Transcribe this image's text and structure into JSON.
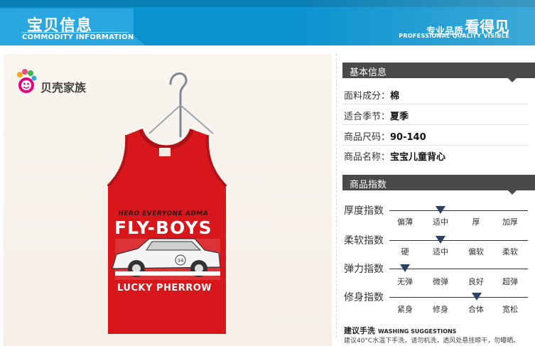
{
  "header": {
    "title": "宝贝信息",
    "subtitle": "COMMODITY INFORMATION",
    "slogan_small": "专业品质",
    "slogan_big": "看得见",
    "slogan_en": "PROFESSIONAL QUALITY VISIBLE"
  },
  "product": {
    "brand_logo_text": "贝壳家族",
    "print_small": "HERO EVERYONE ADMA",
    "print_big": "FLY-BOYS",
    "print_bottom": "LUCKY PHERROW",
    "car_number": "34",
    "colors": {
      "shirt": "#d8171c",
      "banner": "#0b93cf",
      "tab": "#2aa7e0",
      "section_head": "#4a4a4a"
    }
  },
  "basic_info": {
    "heading": "基本信息",
    "rows": [
      {
        "key": "面料成分：",
        "value": "棉"
      },
      {
        "key": "适合季节：",
        "value": "夏季"
      },
      {
        "key": "商品尺码：",
        "value": "90-140"
      },
      {
        "key": "商品名称：",
        "value": "宝宝儿童背心"
      }
    ]
  },
  "indices": {
    "heading": "商品指数",
    "scales": [
      {
        "label": "厚度指数",
        "options": [
          "偏薄",
          "适中",
          "厚",
          "加厚"
        ],
        "selected": 1
      },
      {
        "label": "柔软指数",
        "options": [
          "硬",
          "适中",
          "偏软",
          "柔软"
        ],
        "selected": 1
      },
      {
        "label": "弹力指数",
        "options": [
          "无弹",
          "微弹",
          "良好",
          "超弹"
        ],
        "selected": 0
      },
      {
        "label": "修身指数",
        "options": [
          "紧身",
          "修身",
          "合体",
          "宽松"
        ],
        "selected": 2
      }
    ]
  },
  "washing": {
    "title": "建议手洗",
    "title_en": "WASHING SUGGESTIONS",
    "text": "建议40°C水温下手洗，请勿机洗，透风处悬挂晾干，勿曝晒。"
  }
}
